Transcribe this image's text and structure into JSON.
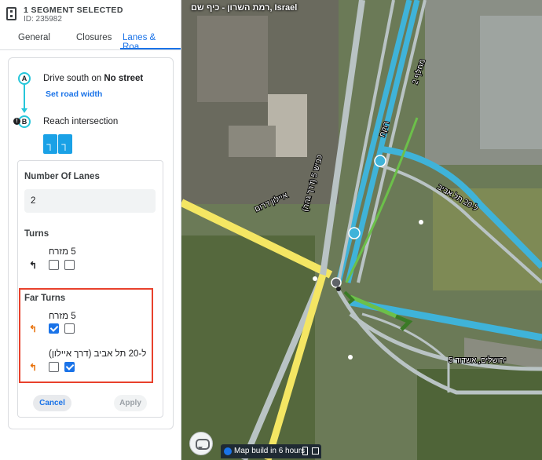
{
  "header": {
    "title": "1 SEGMENT SELECTED",
    "id_label": "ID: 235982"
  },
  "tabs": [
    {
      "label": "General"
    },
    {
      "label": "Closures"
    },
    {
      "label": "Lanes & Roa..."
    }
  ],
  "route": {
    "point_a": "A",
    "point_b": "B",
    "drive_prefix": "Drive south on ",
    "drive_street": "No street",
    "set_width": "Set road width",
    "reach": "Reach intersection"
  },
  "lanes": {
    "number_label": "Number Of Lanes",
    "number_value": "2",
    "turns_label": "Turns",
    "turns": [
      {
        "name": "5 מזרח",
        "arrow": "↰",
        "lane1_checked": false,
        "lane2_checked": false
      }
    ],
    "far_turns_label": "Far Turns",
    "far_turns": [
      {
        "name": "5 מזרח",
        "arrow": "↰",
        "lane1_checked": true,
        "lane2_checked": false
      },
      {
        "name": "ל-20 תל אביב (דרך איילון)",
        "arrow": "↰",
        "lane1_checked": false,
        "lane2_checked": true
      }
    ]
  },
  "buttons": {
    "cancel": "Cancel",
    "apply": "Apply"
  },
  "map": {
    "location": "רמת השרון - כיף שם, Israel",
    "build_status": "Map build in 6 hours",
    "road_labels": [
      "איילון דרום",
      "כביש 5 (דרך גהה)",
      "ל-20 תל אביב",
      "5 ירושלים, אשדוד",
      "רוקח",
      "מחלף 2"
    ]
  },
  "colors": {
    "accent": "#1a73e8",
    "lane_indicator": "#1aa1e6",
    "highlight_border": "#e8412c",
    "far_turn_arrow": "#e8710a",
    "road_blue": "#3fb3d9",
    "road_yellow": "#f4e663",
    "road_gray": "#b9c3c4",
    "segment_green": "#6cc04a"
  },
  "icons": {
    "segment": "segment-icon",
    "chat": "chat-icon",
    "phone": "phone-icon",
    "external": "external-link-icon"
  }
}
